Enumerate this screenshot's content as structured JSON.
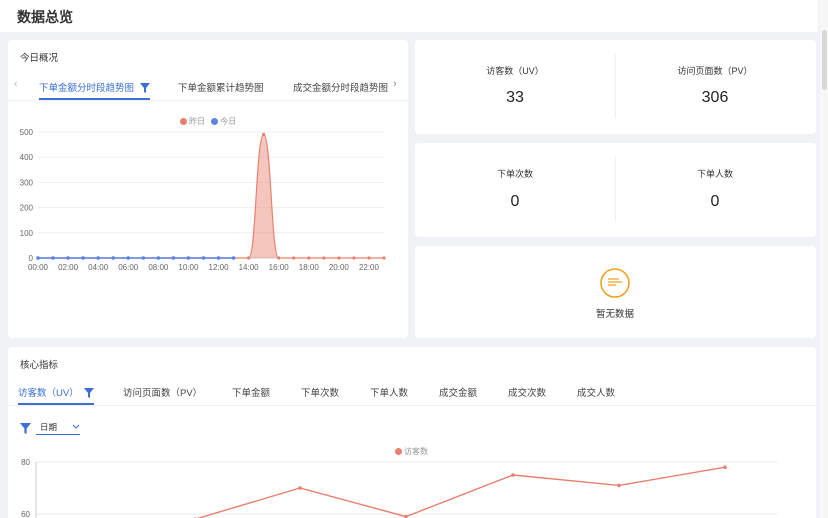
{
  "page": {
    "title": "数据总览"
  },
  "today_overview": {
    "title": "今日概况",
    "tabs": [
      {
        "label": "下单金额分时段趋势图",
        "active": true
      },
      {
        "label": "下单金额累计趋势图",
        "active": false
      },
      {
        "label": "成交金额分时段趋势图",
        "active": false
      }
    ],
    "prev_icon": "chevron-left-icon",
    "next_icon": "chevron-right-icon"
  },
  "stats": {
    "uv_label": "访客数（UV）",
    "uv_value": "33",
    "pv_label": "访问页面数（PV）",
    "pv_value": "306",
    "orders_label": "下单次数",
    "orders_value": "0",
    "buyers_label": "下单人数",
    "buyers_value": "0",
    "empty_text": "暂无数据"
  },
  "core": {
    "title": "核心指标",
    "tabs": [
      {
        "label": "访客数（UV）",
        "active": true
      },
      {
        "label": "访问页面数（PV）",
        "active": false
      },
      {
        "label": "下单金额",
        "active": false
      },
      {
        "label": "下单次数",
        "active": false
      },
      {
        "label": "下单人数",
        "active": false
      },
      {
        "label": "成交金额",
        "active": false
      },
      {
        "label": "成交次数",
        "active": false
      },
      {
        "label": "成交人数",
        "active": false
      }
    ],
    "date_select": "日期"
  },
  "colors": {
    "accent": "#3a6fd8",
    "yesterday": "#e8806e",
    "today": "#5b83e3"
  },
  "chart_data": [
    {
      "type": "line",
      "x": [
        "00:00",
        "01:00",
        "02:00",
        "03:00",
        "04:00",
        "05:00",
        "06:00",
        "07:00",
        "08:00",
        "09:00",
        "10:00",
        "11:00",
        "12:00",
        "13:00",
        "14:00",
        "15:00",
        "16:00",
        "17:00",
        "18:00",
        "19:00",
        "20:00",
        "21:00",
        "22:00",
        "23:00"
      ],
      "x_tick_labels": [
        "00:00",
        "02:00",
        "04:00",
        "06:00",
        "08:00",
        "10:00",
        "12:00",
        "14:00",
        "16:00",
        "18:00",
        "20:00",
        "22:00"
      ],
      "series": [
        {
          "name": "昨日",
          "color": "#e8806e",
          "area": true,
          "values": [
            0,
            0,
            0,
            0,
            0,
            0,
            0,
            0,
            0,
            0,
            0,
            0,
            0,
            0,
            0,
            490,
            0,
            0,
            0,
            0,
            0,
            0,
            0,
            0
          ]
        },
        {
          "name": "今日",
          "color": "#5b83e3",
          "values": [
            0,
            0,
            0,
            0,
            0,
            0,
            0,
            0,
            0,
            0,
            0,
            0,
            0,
            0
          ]
        }
      ],
      "ylim": [
        0,
        500
      ],
      "y_ticks": [
        0,
        100,
        200,
        300,
        400,
        500
      ],
      "grid": true,
      "legend": "top-center"
    },
    {
      "type": "line",
      "series": [
        {
          "name": "访客数",
          "color": "#e8806e",
          "values": [
            58,
            70,
            59,
            75,
            71,
            78
          ]
        }
      ],
      "ylim": [
        60,
        80
      ],
      "y_ticks": [
        60,
        80
      ],
      "grid": true,
      "legend": "top-center"
    }
  ]
}
